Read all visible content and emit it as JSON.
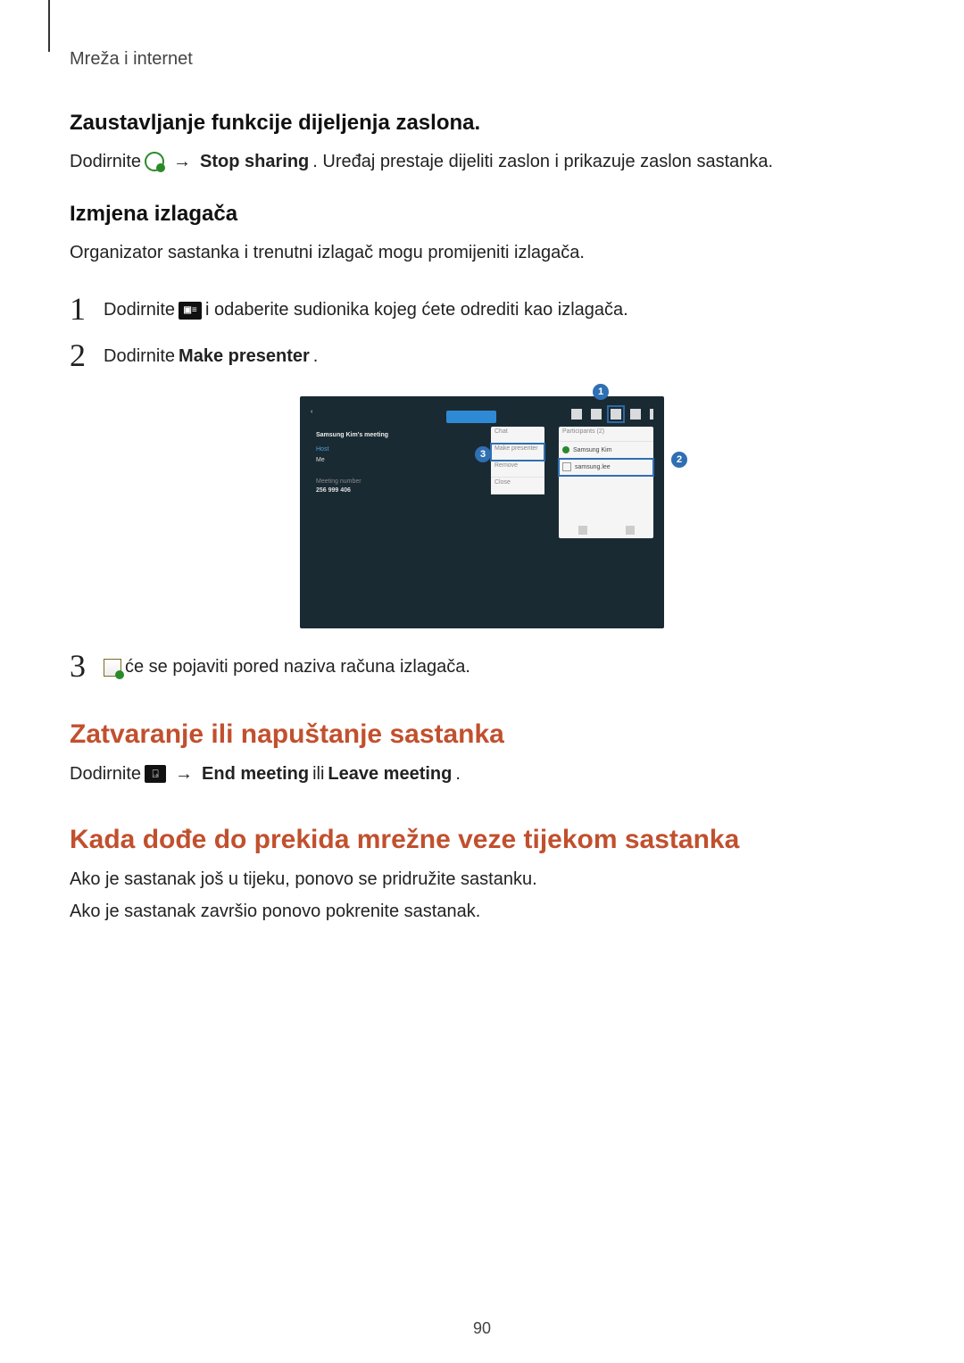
{
  "breadcrumb": "Mreža i internet",
  "stop_sharing": {
    "heading": "Zaustavljanje funkcije dijeljenja zaslona.",
    "pre": "Dodirnite ",
    "arrow": "→",
    "action": "Stop sharing",
    "post": ". Uređaj prestaje dijeliti zaslon i prikazuje zaslon sastanka."
  },
  "change_presenter": {
    "heading": "Izmjena izlagača",
    "intro": "Organizator sastanka i trenutni izlagač mogu promijeniti izlagača.",
    "step1_num": "1",
    "step1_pre": "Dodirnite ",
    "step1_post": " i odaberite sudionika kojeg ćete odrediti kao izlagača.",
    "step2_num": "2",
    "step2_pre": "Dodirnite ",
    "step2_action": "Make presenter",
    "step2_post": ".",
    "step3_num": "3",
    "step3_post": " će se pojaviti pored naziva računa izlagača."
  },
  "callouts": {
    "c1": "1",
    "c2": "2",
    "c3": "3"
  },
  "figure": {
    "back": "‹",
    "title": "Samsung Kim's meeting",
    "host": "Host",
    "me": "Me",
    "meeting_label": "Meeting number",
    "code": "256 999 406",
    "menu": {
      "m1": "Chat",
      "m2": "Make presenter",
      "m3": "Remove",
      "m4": "Close"
    },
    "panel": {
      "head": "Participants (2)",
      "row1": "Samsung Kim",
      "row2": "samsung.lee"
    }
  },
  "close_meeting": {
    "title": "Zatvaranje ili napuštanje sastanka",
    "pre": "Dodirnite ",
    "arrow": "→",
    "a1": "End meeting",
    "mid": " ili ",
    "a2": "Leave meeting",
    "post": "."
  },
  "disconnect": {
    "title": "Kada dođe do prekida mrežne veze tijekom sastanka",
    "p1": "Ako je sastanak još u tijeku, ponovo se pridružite sastanku.",
    "p2": "Ako je sastanak završio ponovo pokrenite sastanak."
  },
  "page_number": "90"
}
